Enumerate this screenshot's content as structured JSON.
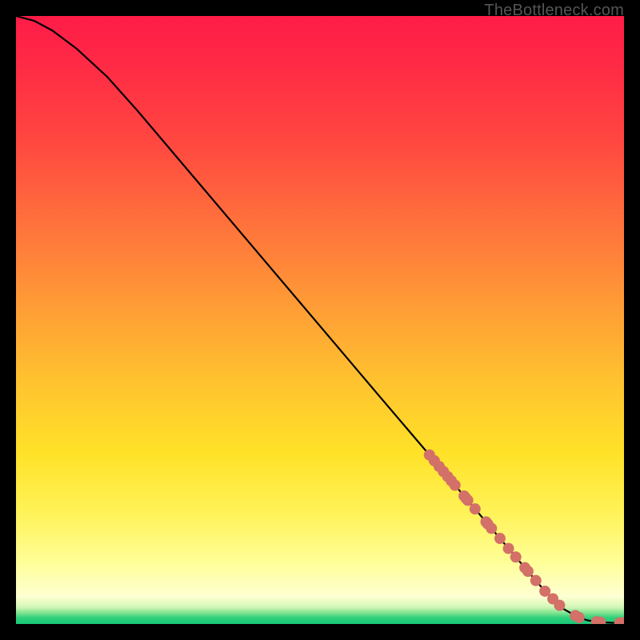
{
  "watermark": "TheBottleneck.com",
  "chart_data": {
    "type": "line",
    "title": "",
    "xlabel": "",
    "ylabel": "",
    "xlim": [
      0,
      100
    ],
    "ylim": [
      0,
      100
    ],
    "series": [
      {
        "name": "curve",
        "x": [
          0,
          3,
          6,
          10,
          15,
          20,
          30,
          40,
          50,
          60,
          68,
          74,
          80,
          84,
          87,
          90,
          92.5,
          94,
          96,
          98,
          100
        ],
        "y": [
          100,
          99.2,
          97.6,
          94.6,
          90.0,
          84.4,
          72.6,
          60.8,
          49.0,
          37.2,
          27.8,
          20.7,
          13.6,
          8.9,
          5.4,
          2.5,
          1.1,
          0.6,
          0.3,
          0.2,
          0.2
        ]
      }
    ],
    "dots_on_curve_x": [
      68.0,
      68.8,
      69.6,
      70.3,
      71.0,
      71.6,
      72.2,
      73.7,
      74.0,
      74.3,
      75.5,
      77.3,
      77.6,
      78.2,
      79.6,
      81.0,
      82.2,
      83.7,
      84.2,
      85.5,
      87.0,
      88.3,
      89.4,
      92.0,
      92.6,
      95.5,
      96.1,
      99.3,
      100.0
    ],
    "dot_color": "#d37068",
    "dot_radius": 7
  }
}
